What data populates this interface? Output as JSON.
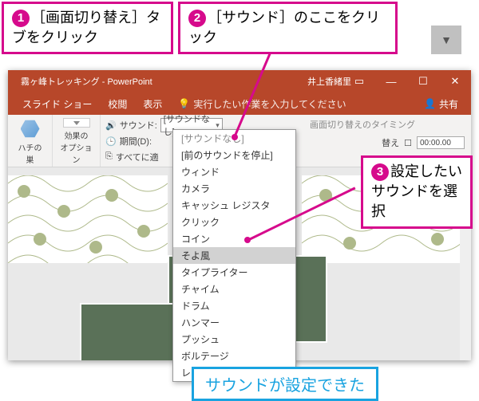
{
  "callouts": {
    "c1_num": "1",
    "c1_text": "［画面切り替え］タブをクリック",
    "c2_num": "2",
    "c2_text": "［サウンド］のここをクリック",
    "c3_num": "3",
    "c3_text": "設定したいサウンドを選択"
  },
  "result_text": "サウンドが設定できた",
  "arrow_glyph": "▼",
  "titlebar": {
    "title": "霧ヶ峰トレッキング - PowerPoint",
    "user": "井上香緒里",
    "ribmin": "▭",
    "min": "—",
    "max": "☐",
    "close": "✕"
  },
  "tabs": {
    "slideshow": "スライド ショー",
    "review": "校閲",
    "view": "表示",
    "tellme_icon": "💡",
    "tellme": "実行したい作業を入力してください",
    "share_icon": "👤",
    "share": "共有"
  },
  "ribbon": {
    "honeycomb_label": "ハチの巣",
    "effect_options": "効果の\nオプション",
    "sound_icon": "🔊",
    "sound_label": "サウンド:",
    "sound_value": "[サウンドなし]",
    "sound_chev": "▾",
    "clock_icon": "🕒",
    "duration_label": "期間(D):",
    "applyall_icon": "⎘",
    "applyall_label": "すべてに適",
    "timing_header": "画面切り替えのタイミング",
    "timing_change": "替え",
    "timing_value": "00:00.00",
    "chk": "☐"
  },
  "dropdown": {
    "items": [
      {
        "label": "[サウンドなし]",
        "cls": "header"
      },
      {
        "label": "[前のサウンドを停止]",
        "cls": ""
      },
      {
        "label": "ウィンド",
        "cls": ""
      },
      {
        "label": "カメラ",
        "cls": ""
      },
      {
        "label": "キャッシュ レジスタ",
        "cls": ""
      },
      {
        "label": "クリック",
        "cls": ""
      },
      {
        "label": "コイン",
        "cls": ""
      },
      {
        "label": "そよ風",
        "cls": "hl"
      },
      {
        "label": "タイプライター",
        "cls": ""
      },
      {
        "label": "チャイム",
        "cls": ""
      },
      {
        "label": "ドラム",
        "cls": ""
      },
      {
        "label": "ハンマー",
        "cls": ""
      },
      {
        "label": "プッシュ",
        "cls": ""
      },
      {
        "label": "ボルテージ",
        "cls": ""
      },
      {
        "label": "レーザー",
        "cls": ""
      }
    ]
  }
}
